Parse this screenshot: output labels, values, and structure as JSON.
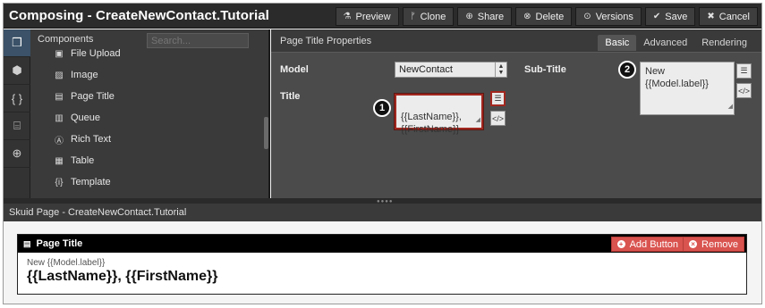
{
  "app": {
    "title": "Composing - CreateNewContact.Tutorial"
  },
  "toolbar": [
    {
      "icon": "⚗",
      "label": "Preview"
    },
    {
      "icon": "ᚠ",
      "label": "Clone"
    },
    {
      "icon": "⊕",
      "label": "Share"
    },
    {
      "icon": "⊗",
      "label": "Delete"
    },
    {
      "icon": "⊙",
      "label": "Versions"
    },
    {
      "icon": "✔",
      "label": "Save"
    },
    {
      "icon": "✖",
      "label": "Cancel"
    }
  ],
  "rail": [
    {
      "icon": "❒",
      "name": "components"
    },
    {
      "icon": "⬢",
      "name": "model"
    },
    {
      "icon": "{ }",
      "name": "javascript"
    },
    {
      "icon": "⌸",
      "name": "css"
    },
    {
      "icon": "⊕",
      "name": "globe"
    }
  ],
  "components": {
    "header": "Components",
    "search_placeholder": "Search...",
    "items": [
      {
        "icon": "▣",
        "label": "File Upload"
      },
      {
        "icon": "▨",
        "label": "Image"
      },
      {
        "icon": "▤",
        "label": "Page Title"
      },
      {
        "icon": "▥",
        "label": "Queue"
      },
      {
        "icon": "Ⓐ",
        "label": "Rich Text"
      },
      {
        "icon": "▦",
        "label": "Table"
      },
      {
        "icon": "{i}",
        "label": "Template"
      }
    ]
  },
  "properties": {
    "title": "Page Title Properties",
    "tabs": [
      "Basic",
      "Advanced",
      "Rendering"
    ],
    "model_label": "Model",
    "model_value": "NewContact",
    "title_label": "Title",
    "title_value": "{{LastName}},\n{{FirstName}}",
    "subtitle_label": "Sub-Title",
    "subtitle_value": "New {{Model.label}}",
    "callout_1": "1",
    "callout_2": "2"
  },
  "preview": {
    "bar_label": "Skuid Page - CreateNewContact.Tutorial",
    "card_header": "Page Title",
    "add_button": "Add Button",
    "remove_button": "Remove",
    "subtitle": "New {{Model.label}}",
    "title": "{{LastName}}, {{FirstName}}"
  },
  "colors": {
    "highlight": "#a2271f",
    "danger": "#d9534f",
    "rail_active": "#3b5268"
  }
}
